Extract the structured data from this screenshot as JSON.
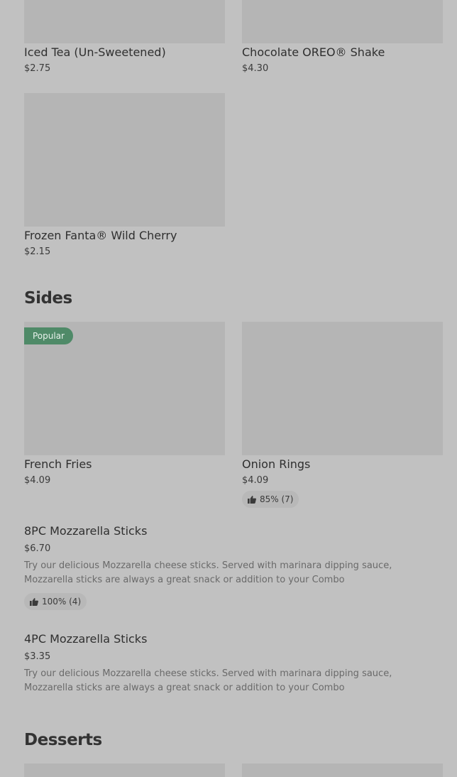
{
  "drinks": {
    "items": [
      {
        "name": "Iced Tea (Un-Sweetened)",
        "price": "$2.75"
      },
      {
        "name": "Chocolate OREO® Shake",
        "price": "$4.30"
      },
      {
        "name": "Frozen Fanta® Wild Cherry",
        "price": "$2.15"
      }
    ]
  },
  "sides": {
    "title": "Sides",
    "popular_badge": "Popular",
    "items": [
      {
        "name": "French Fries",
        "price": "$4.09"
      },
      {
        "name": "Onion Rings",
        "price": "$4.09",
        "rating": "85% (7)"
      },
      {
        "name": "8PC Mozzarella Sticks",
        "price": "$6.70",
        "description": "Try our delicious Mozzarella cheese sticks. Served with marinara dipping sauce, Mozzarella sticks are always a great snack or addition to your Combo",
        "rating": "100% (4)"
      },
      {
        "name": "4PC Mozzarella Sticks",
        "price": "$3.35",
        "description": "Try our delicious Mozzarella cheese sticks. Served with marinara dipping sauce, Mozzarella sticks are always a great snack or addition to your Combo"
      }
    ]
  },
  "desserts": {
    "title": "Desserts"
  },
  "icons": {
    "rating": "thumbs-up-icon"
  },
  "colors": {
    "background": "#c1c1c1",
    "image_placeholder": "#b5b5b5",
    "popular_badge": "#4f8a68",
    "rating_pill": "#b8b8b8"
  }
}
